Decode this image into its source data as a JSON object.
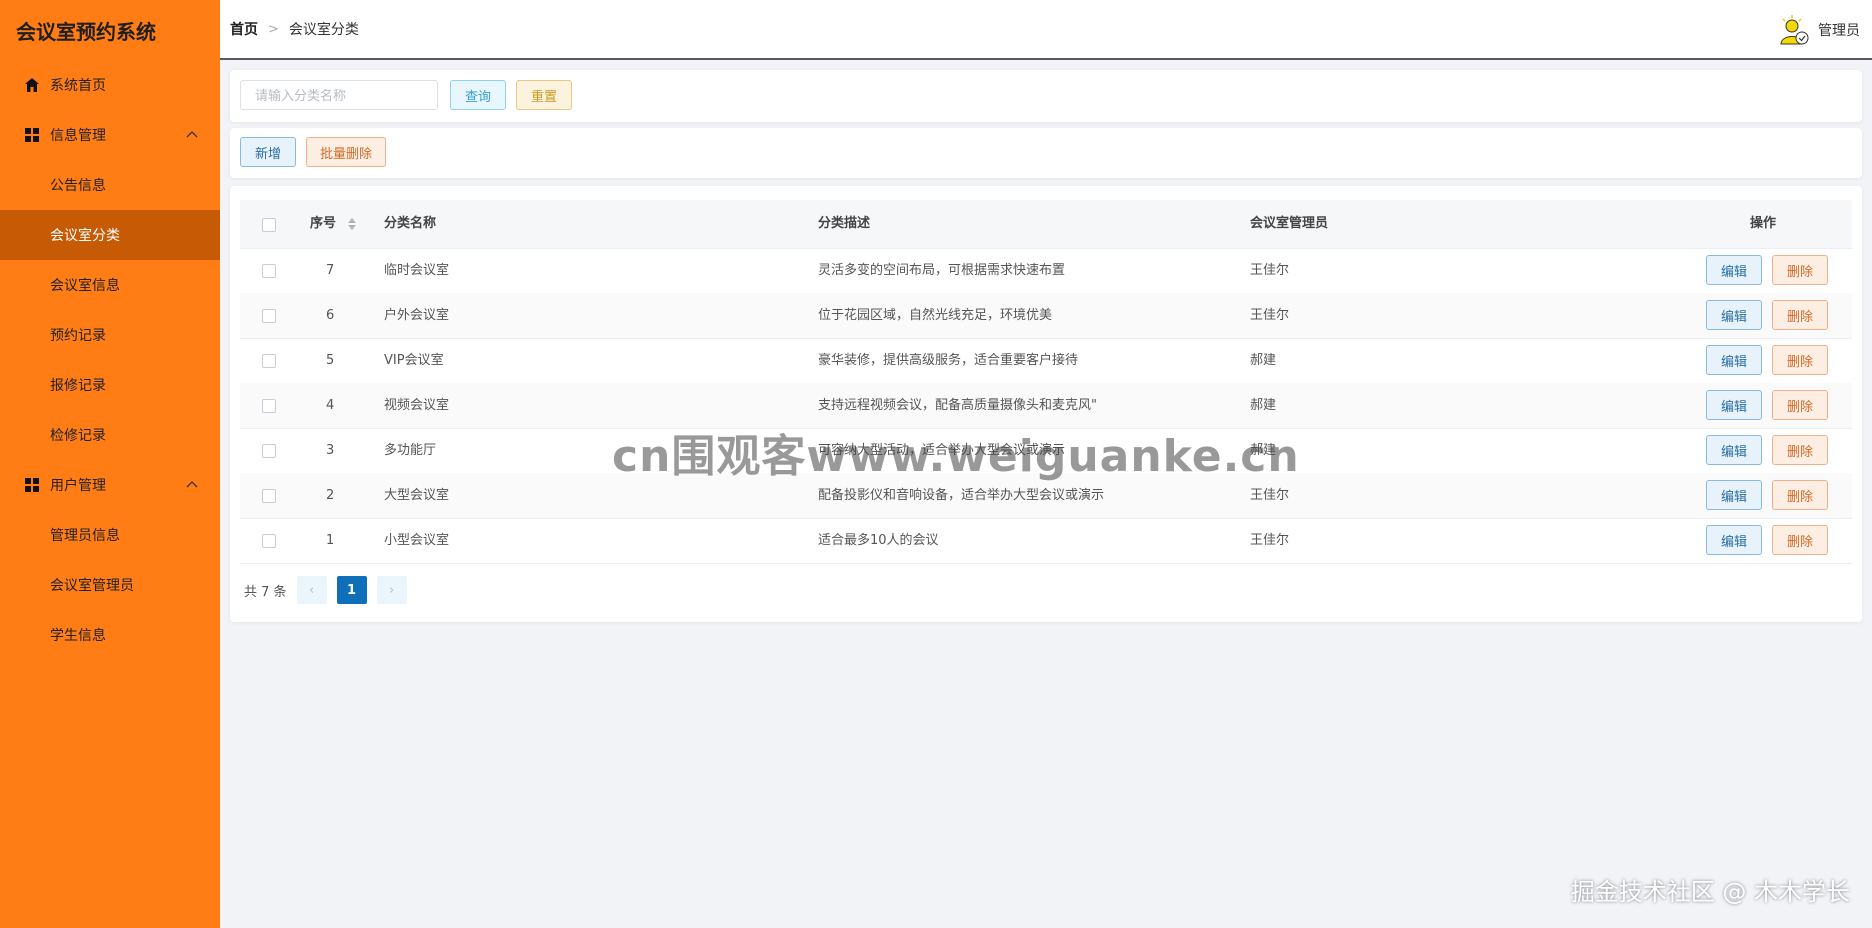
{
  "app": {
    "title": "会议室预约系统"
  },
  "sidebar": {
    "items": [
      {
        "label": "系统首页",
        "icon": "home-icon"
      },
      {
        "label": "信息管理",
        "icon": "grid-icon"
      },
      {
        "label": "公告信息"
      },
      {
        "label": "会议室分类",
        "active": true
      },
      {
        "label": "会议室信息"
      },
      {
        "label": "预约记录"
      },
      {
        "label": "报修记录"
      },
      {
        "label": "检修记录"
      },
      {
        "label": "用户管理",
        "icon": "grid-icon"
      },
      {
        "label": "管理员信息"
      },
      {
        "label": "会议室管理员"
      },
      {
        "label": "学生信息"
      }
    ]
  },
  "header": {
    "breadcrumb": {
      "home": "首页",
      "current": "会议室分类"
    },
    "user": "管理员"
  },
  "search": {
    "placeholder": "请输入分类名称",
    "value": "",
    "query_label": "查询",
    "reset_label": "重置"
  },
  "actions": {
    "add_label": "新增",
    "batch_delete_label": "批量删除"
  },
  "table": {
    "columns": [
      "序号",
      "分类名称",
      "分类描述",
      "会议室管理员",
      "操作"
    ],
    "rows": [
      {
        "id": "7",
        "name": "临时会议室",
        "desc": "灵活多变的空间布局，可根据需求快速布置",
        "manager": "王佳尔"
      },
      {
        "id": "6",
        "name": "户外会议室",
        "desc": "位于花园区域，自然光线充足，环境优美",
        "manager": "王佳尔"
      },
      {
        "id": "5",
        "name": "VIP会议室",
        "desc": "豪华装修，提供高级服务，适合重要客户接待",
        "manager": "郝建"
      },
      {
        "id": "4",
        "name": "视频会议室",
        "desc": "支持远程视频会议，配备高质量摄像头和麦克风\"",
        "manager": "郝建"
      },
      {
        "id": "3",
        "name": "多功能厅",
        "desc": "可容纳大型活动，适合举办大型会议或演示",
        "manager": "郝建"
      },
      {
        "id": "2",
        "name": "大型会议室",
        "desc": "配备投影仪和音响设备，适合举办大型会议或演示",
        "manager": "王佳尔"
      },
      {
        "id": "1",
        "name": "小型会议室",
        "desc": "适合最多10人的会议",
        "manager": "王佳尔"
      }
    ],
    "edit_label": "编辑",
    "delete_label": "删除"
  },
  "pagination": {
    "total_text": "共 7 条",
    "current_page": "1",
    "prev": "‹",
    "next": "›"
  },
  "watermarks": {
    "center": "cn围观客www.weiguanke.cn",
    "corner": "掘金技术社区 @ 木木学长"
  },
  "colors": {
    "sidebar": "#ff7d14",
    "active_item": "#c65a05",
    "pager_current": "#0f6fb8"
  }
}
